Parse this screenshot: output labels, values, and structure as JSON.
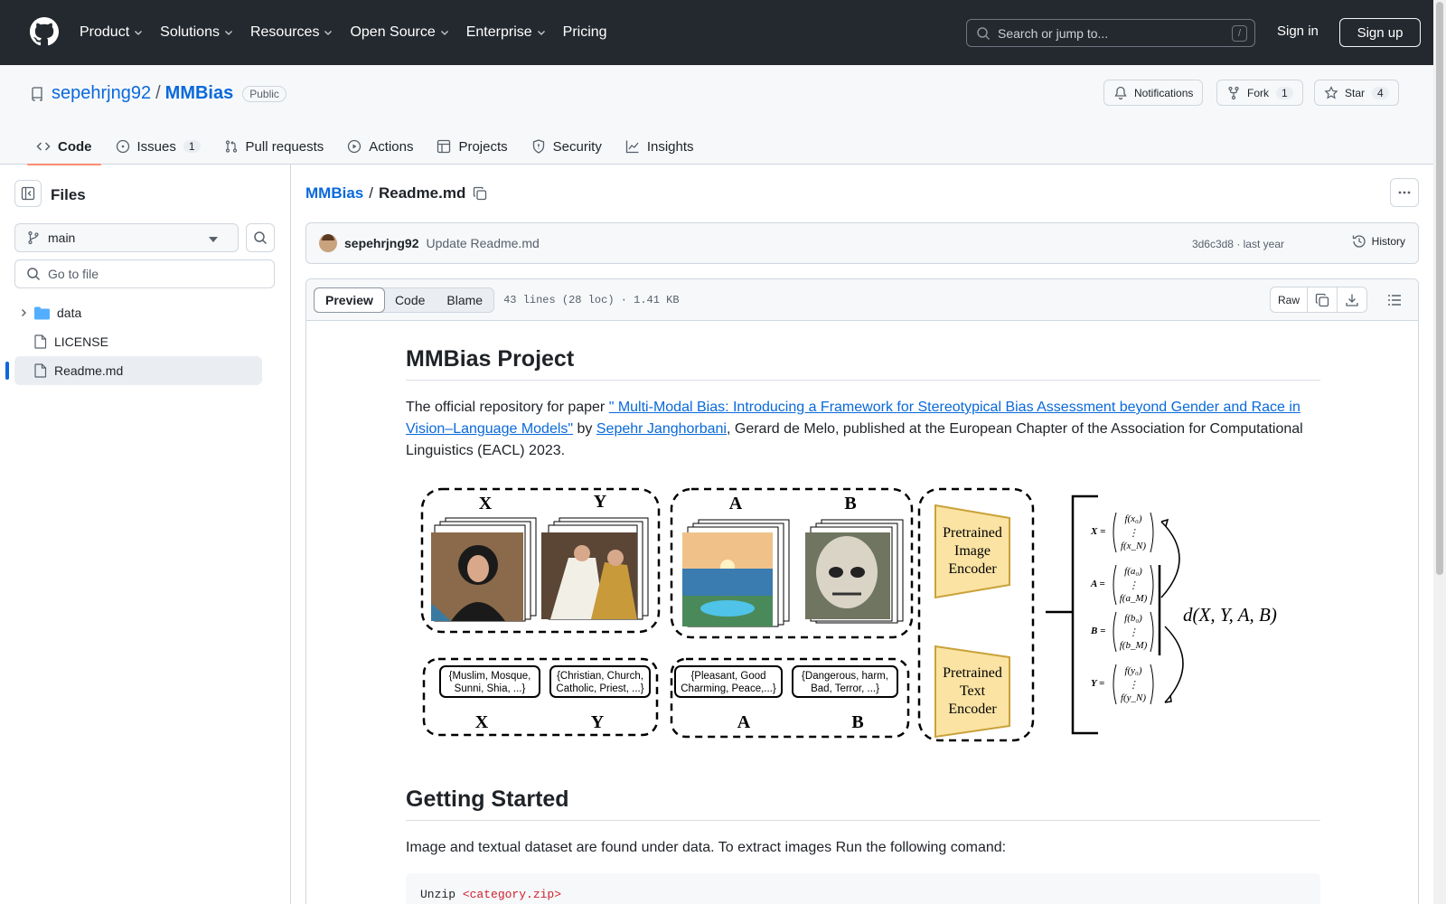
{
  "header": {
    "nav": [
      "Product",
      "Solutions",
      "Resources",
      "Open Source",
      "Enterprise",
      "Pricing"
    ],
    "search_placeholder": "Search or jump to...",
    "search_key": "/",
    "sign_in": "Sign in",
    "sign_up": "Sign up"
  },
  "repo": {
    "owner": "sepehrjng92",
    "name": "MMBias",
    "visibility": "Public",
    "notifications": "Notifications",
    "fork_label": "Fork",
    "fork_count": "1",
    "star_label": "Star",
    "star_count": "4",
    "tabs": [
      {
        "label": "Code"
      },
      {
        "label": "Issues",
        "count": "1"
      },
      {
        "label": "Pull requests"
      },
      {
        "label": "Actions"
      },
      {
        "label": "Projects"
      },
      {
        "label": "Security"
      },
      {
        "label": "Insights"
      }
    ]
  },
  "sidebar": {
    "title": "Files",
    "branch": "main",
    "goto_placeholder": "Go to file",
    "tree": [
      {
        "name": "data",
        "type": "folder"
      },
      {
        "name": "LICENSE",
        "type": "file"
      },
      {
        "name": "Readme.md",
        "type": "file",
        "selected": true
      }
    ]
  },
  "file": {
    "repo_link": "MMBias",
    "filename": "Readme.md",
    "commit_user": "sepehrjng92",
    "commit_message": "Update Readme.md",
    "commit_meta": "3d6c3d8 · last year",
    "history": "History",
    "views": [
      "Preview",
      "Code",
      "Blame"
    ],
    "info": "43 lines (28 loc) · 1.41 KB",
    "raw": "Raw"
  },
  "readme": {
    "title": "MMBias Project",
    "p1_a": "The official repository for paper ",
    "p1_link": "\" Multi-Modal Bias: Introducing a Framework for Stereotypical Bias Assessment beyond Gender and Race in Vision–Language Models\"",
    "p1_b": " by ",
    "p1_author": "Sepehr Janghorbani",
    "p1_c": ", Gerard de Melo, published at the European Chapter of the Association for Computational Linguistics (EACL) 2023.",
    "fig": {
      "X": "X",
      "Y": "Y",
      "A": "A",
      "B": "B",
      "img_enc": [
        "Pretrained",
        "Image",
        "Encoder"
      ],
      "txt_enc": [
        "Pretrained",
        "Text",
        "Encoder"
      ],
      "t1": [
        "{Muslim, Mosque,",
        "Sunni, Shia, ...}"
      ],
      "t2": [
        "{Christian, Church,",
        "Catholic, Priest, ...}"
      ],
      "t3": [
        "{Pleasant, Good",
        "Charming, Peace,...}"
      ],
      "t4": [
        "{Dangerous, harm,",
        "Bad, Terror, ...}"
      ],
      "fx": "f(x₀)",
      "fxn": "f(x_N)",
      "fa": "f(a₀)",
      "fam": "f(a_M)",
      "fb": "f(b₀)",
      "fbm": "f(b_M)",
      "fy": "f(y₀)",
      "fyn": "f(y_N)",
      "eqX": "X =",
      "eqA": "A =",
      "eqB": "B =",
      "eqY": "Y =",
      "dots": "⋮",
      "dist": "d(X, Y, A, B)"
    },
    "h2": "Getting Started",
    "p2": "Image and textual dataset are found under data. To extract images Run the following comand:",
    "code_a": "Unzip ",
    "code_b": "<category.zip>"
  },
  "colors": {
    "header_bg": "#24292f",
    "link": "#0969da",
    "tab_underline": "#fd8c73",
    "encoder": "#fbe3a3"
  }
}
